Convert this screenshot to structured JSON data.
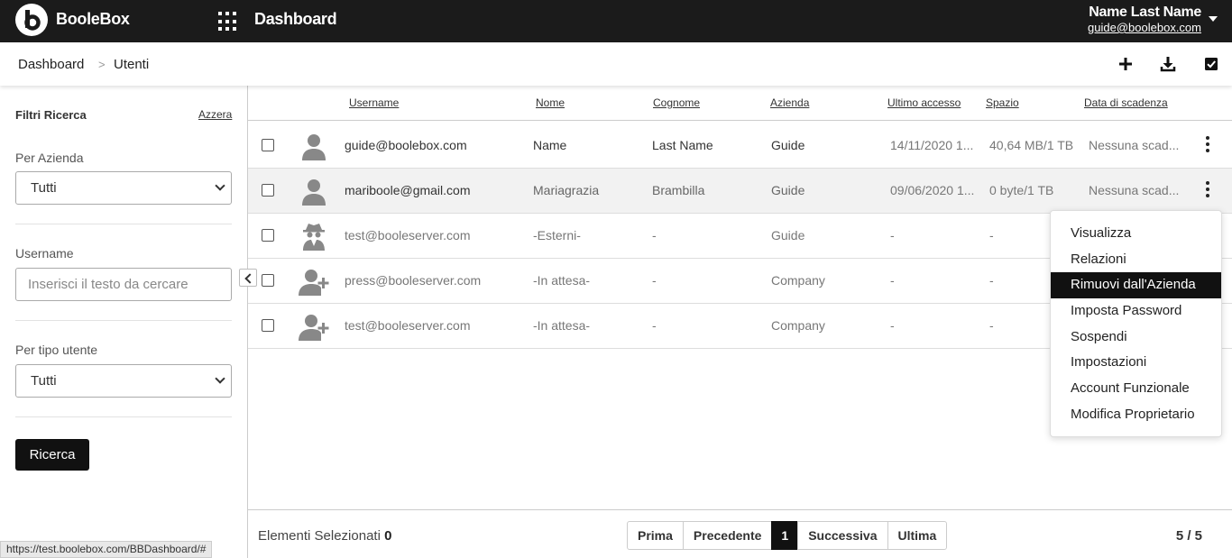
{
  "header": {
    "brand": "BooleBox",
    "title": "Dashboard",
    "user_name": "Name Last Name",
    "user_email": "guide@boolebox.com"
  },
  "breadcrumb": {
    "root": "Dashboard",
    "separator": ">",
    "current": "Utenti"
  },
  "toolbar": {
    "add_icon": "plus-icon",
    "download_icon": "download-icon",
    "select_icon": "checkbox-icon"
  },
  "sidebar": {
    "title": "Filtri Ricerca",
    "reset": "Azzera",
    "company_label": "Per Azienda",
    "company_value": "Tutti",
    "username_label": "Username",
    "username_placeholder": "Inserisci il testo da cercare",
    "type_label": "Per tipo utente",
    "type_value": "Tutti",
    "search_button": "Ricerca"
  },
  "table": {
    "columns": [
      "Username",
      "Nome",
      "Cognome",
      "Azienda",
      "Ultimo accesso",
      "Spazio",
      "Data di scadenza"
    ],
    "rows": [
      {
        "username": "guide@boolebox.com",
        "nome": "Name",
        "cognome": "Last Name",
        "azienda": "Guide",
        "ultimo_accesso": "14/11/2020 1...",
        "spazio": "40,64 MB/1 TB",
        "scadenza": "Nessuna scad...",
        "avatar": "user-icon"
      },
      {
        "username": "mariboole@gmail.com",
        "nome": "Mariagrazia",
        "cognome": "Brambilla",
        "azienda": "Guide",
        "ultimo_accesso": "09/06/2020 1...",
        "spazio": "0 byte/1 TB",
        "scadenza": "Nessuna scad...",
        "avatar": "user-icon"
      },
      {
        "username": "test@booleserver.com",
        "nome": "-Esterni-",
        "cognome": "-",
        "azienda": "Guide",
        "ultimo_accesso": "-",
        "spazio": "-",
        "scadenza": "",
        "avatar": "spy-user-icon"
      },
      {
        "username": "press@booleserver.com",
        "nome": "-In attesa-",
        "cognome": "-",
        "azienda": "Company",
        "ultimo_accesso": "-",
        "spazio": "-",
        "scadenza": "",
        "avatar": "user-plus-icon"
      },
      {
        "username": "test@booleserver.com",
        "nome": "-In attesa-",
        "cognome": "-",
        "azienda": "Company",
        "ultimo_accesso": "-",
        "spazio": "-",
        "scadenza": "",
        "avatar": "user-plus-icon"
      }
    ]
  },
  "context_menu": {
    "items": [
      "Visualizza",
      "Relazioni",
      "Rimuovi dall'Azienda",
      "Imposta Password",
      "Sospendi",
      "Impostazioni",
      "Account Funzionale",
      "Modifica Proprietario"
    ],
    "highlighted": "Rimuovi dall'Azienda"
  },
  "footer": {
    "selected_label": "Elementi Selezionati",
    "selected_count": "0",
    "pager": {
      "first": "Prima",
      "prev": "Precedente",
      "current": "1",
      "next": "Successiva",
      "last": "Ultima"
    },
    "total": "5 / 5"
  },
  "status_url": "https://test.boolebox.com/BBDashboard/#",
  "colors": {
    "topbar": "#1b1b1b",
    "accent": "#111111",
    "row_shaded": "#f2f2f2"
  }
}
